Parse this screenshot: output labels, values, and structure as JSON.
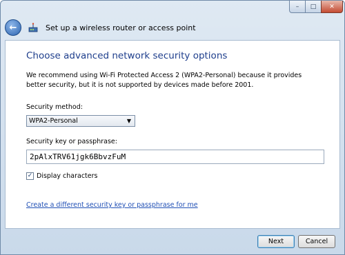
{
  "window": {
    "nav_title": "Set up a wireless router or access point",
    "controls": {
      "minimize": "–",
      "maximize": "□",
      "close": "✕"
    }
  },
  "content": {
    "heading": "Choose advanced network security options",
    "description": "We recommend using Wi-Fi Protected Access 2 (WPA2-Personal) because it provides better security,  but it is not supported by devices made before 2001.",
    "security_method": {
      "label": "Security method:",
      "value": "WPA2-Personal"
    },
    "security_key": {
      "label": "Security key or passphrase:",
      "value": "2pAlxTRV61jgk6BbvzFuM"
    },
    "display_characters": {
      "label": "Display characters",
      "checked": true,
      "mark": "✓"
    },
    "link": "Create a different security key or passphrase for me"
  },
  "footer": {
    "next": "Next",
    "cancel": "Cancel"
  },
  "icons": {
    "back": "back-arrow-icon",
    "wizard": "network-setup-icon",
    "dropdown": "chevron-down-icon"
  },
  "colors": {
    "heading": "#1e3e8c",
    "link": "#1f4fb5",
    "chrome": "#c9d9ea"
  }
}
